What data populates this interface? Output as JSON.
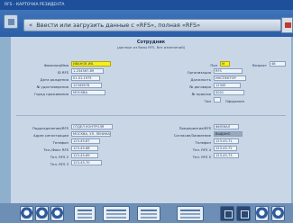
{
  "window": {
    "title": "RFS - КАРТОЧКА РЕЗИДЕНТА"
  },
  "header": {
    "nav_glyph": "«",
    "title": "Ввести или загрузить данные с «RFS», полная «RFS»"
  },
  "form": {
    "title": "Сотрудник",
    "subtitle": "(данные из базы RFS, без изменений)",
    "left_top": [
      {
        "label": "Фамилия/Имя",
        "value": "ИВАНОВ ИВ."
      },
      {
        "label": "ID RFS",
        "value": "1-234567-89"
      },
      {
        "label": "Дата рождения",
        "value": "01.01.1975"
      },
      {
        "label": "№ удостоверения",
        "value": "12345678"
      },
      {
        "label": "Город проживания",
        "value": "МОСКВА"
      }
    ],
    "right_top": {
      "pol_label": "Пол",
      "pol_value": "М",
      "vozrast_label": "Возраст",
      "vozrast_value": "46",
      "rows": [
        {
          "label": "Организация",
          "value": "RFS"
        },
        {
          "label": "Должность",
          "value": "ИНСПЕКТОР"
        },
        {
          "label": "№ договора",
          "value": "12345"
        },
        {
          "label": "№ приказа",
          "value": "0001"
        }
      ],
      "checkbox_label": "Тип",
      "checkbox_hint": "Оформлен"
    },
    "left_bottom": [
      {
        "label": "Подразделение/RFS",
        "value": "ОТДЕЛ КОНТРОЛЯ"
      },
      {
        "label": "Адрес регистрации",
        "value": "МОСКВА, УЛ. ЛЕНИНА"
      },
      {
        "label": "Телефон",
        "value": "123-45-67"
      },
      {
        "label": "Тел./Факс RFS",
        "value": "123-45-68"
      },
      {
        "label": "Тел. RFS 2",
        "value": "123-45-69"
      },
      {
        "label": "Тел. RFS 3",
        "value": "123-45-70"
      }
    ],
    "right_bottom": [
      {
        "label": "Предприятие/RFS",
        "value": "ФИЛИАЛ"
      },
      {
        "label": "Согласие/Заявление",
        "value": "ВЫДАНО"
      },
      {
        "label": "Телефон",
        "value": "123-45-71"
      },
      {
        "label": "Тел. RFS 4",
        "value": "123-45-72"
      },
      {
        "label": "Тел. RFS 5",
        "value": "123-45-73"
      }
    ]
  },
  "taskbar": {
    "items": [
      "round-button-1",
      "round-button-2",
      "round-button-3",
      "doc-button-1",
      "doc-button-2",
      "doc-button-3",
      "doc-button-4",
      "dark-button-1",
      "dark-button-2",
      "round-button-4",
      "round-button-5"
    ]
  }
}
